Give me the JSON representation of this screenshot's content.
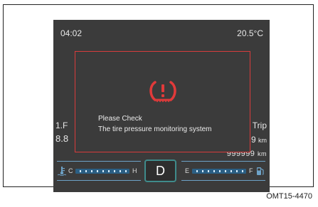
{
  "status": {
    "time": "04:02",
    "temperature": "20.5°C"
  },
  "background": {
    "left_line1": "1.F",
    "left_line2": "8.8",
    "trip_label": "Trip",
    "right_value": "9",
    "right_unit": "km",
    "odometer_value": "999999",
    "odometer_unit": "km"
  },
  "warning": {
    "message_line1": "Please Check",
    "message_line2": "The tire pressure monitoring system",
    "icon": "tpms-warning-icon",
    "border_color": "#d83c3c"
  },
  "gear": {
    "position": "D",
    "border_color": "#3f8b8b"
  },
  "coolant_gauge": {
    "icon": "coolant-temperature-icon",
    "low_label": "C",
    "high_label": "H"
  },
  "fuel_gauge": {
    "icon": "fuel-pump-icon",
    "low_label": "E",
    "high_label": "F"
  },
  "caption": "OMT15-4470"
}
